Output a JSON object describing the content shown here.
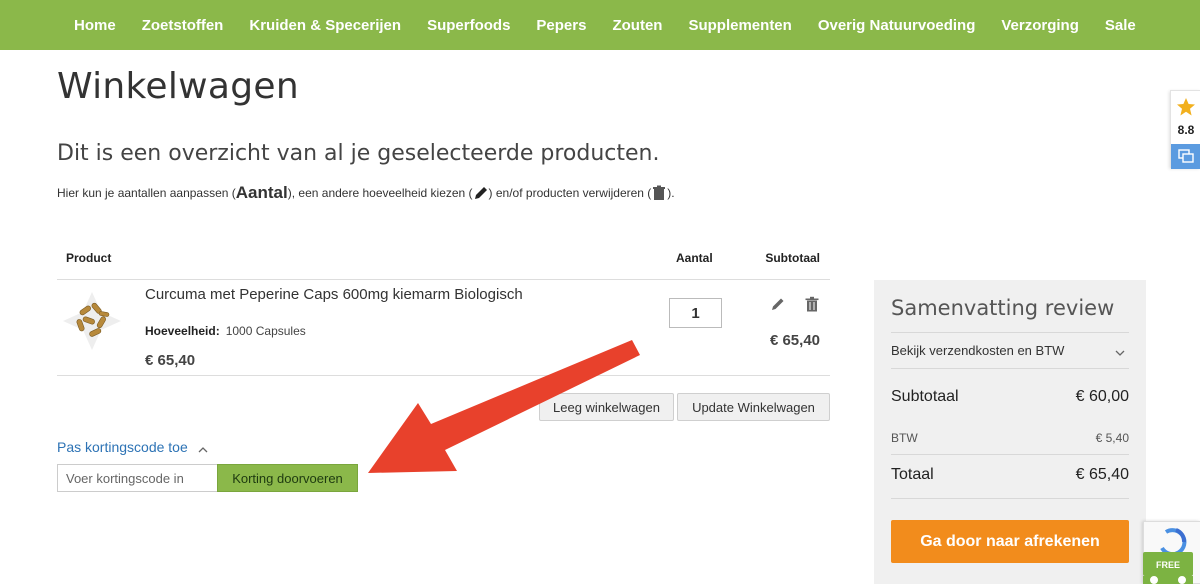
{
  "nav": {
    "items": [
      "Home",
      "Zoetstoffen",
      "Kruiden & Specerijen",
      "Superfoods",
      "Pepers",
      "Zouten",
      "Supplementen",
      "Overig Natuurvoeding",
      "Verzorging",
      "Sale"
    ]
  },
  "page": {
    "title": "Winkelwagen",
    "subtitle": "Dit is een overzicht van al je geselecteerde producten.",
    "help": {
      "part1": "Hier kun je aantallen aanpassen (",
      "bold": "Aantal",
      "part2": "), een andere hoeveelheid kiezen (",
      "part3": ") en/of producten verwijderen (",
      "part4": ")."
    }
  },
  "cart": {
    "headers": {
      "product": "Product",
      "quantity": "Aantal",
      "subtotal": "Subtotaal"
    },
    "items": [
      {
        "name": "Curcuma met Peperine Caps 600mg kiemarm Biologisch",
        "meta_label": "Hoeveelheid:",
        "meta_value": "1000 Capsules",
        "price": "€ 65,40",
        "quantity": "1",
        "subtotal": "€ 65,40"
      }
    ],
    "clear_label": "Leeg winkelwagen",
    "update_label": "Update Winkelwagen"
  },
  "discount": {
    "toggle_label": "Pas kortingscode toe",
    "placeholder": "Voer kortingscode in",
    "apply_label": "Korting doorvoeren"
  },
  "summary": {
    "title": "Samenvatting review",
    "shipping_label": "Bekijk verzendkosten en BTW",
    "subtotal_label": "Subtotaal",
    "subtotal_value": "€ 60,00",
    "btw_label": "BTW",
    "btw_value": "€ 5,40",
    "total_label": "Totaal",
    "total_value": "€ 65,40",
    "checkout_label": "Ga door naar afrekenen"
  },
  "rating_widget": {
    "score": "8.8"
  },
  "free_badge": {
    "label": "FREE"
  },
  "colors": {
    "nav_green": "#8bb84a",
    "checkout_orange": "#f28c1c",
    "link_blue": "#2d73b5",
    "arrow_red": "#e8412c"
  },
  "icons": [
    "pencil-icon",
    "trash-icon",
    "chevron-down-icon",
    "chevron-up-icon",
    "star-icon",
    "chat-icon",
    "recaptcha-icon",
    "truck-icon"
  ]
}
